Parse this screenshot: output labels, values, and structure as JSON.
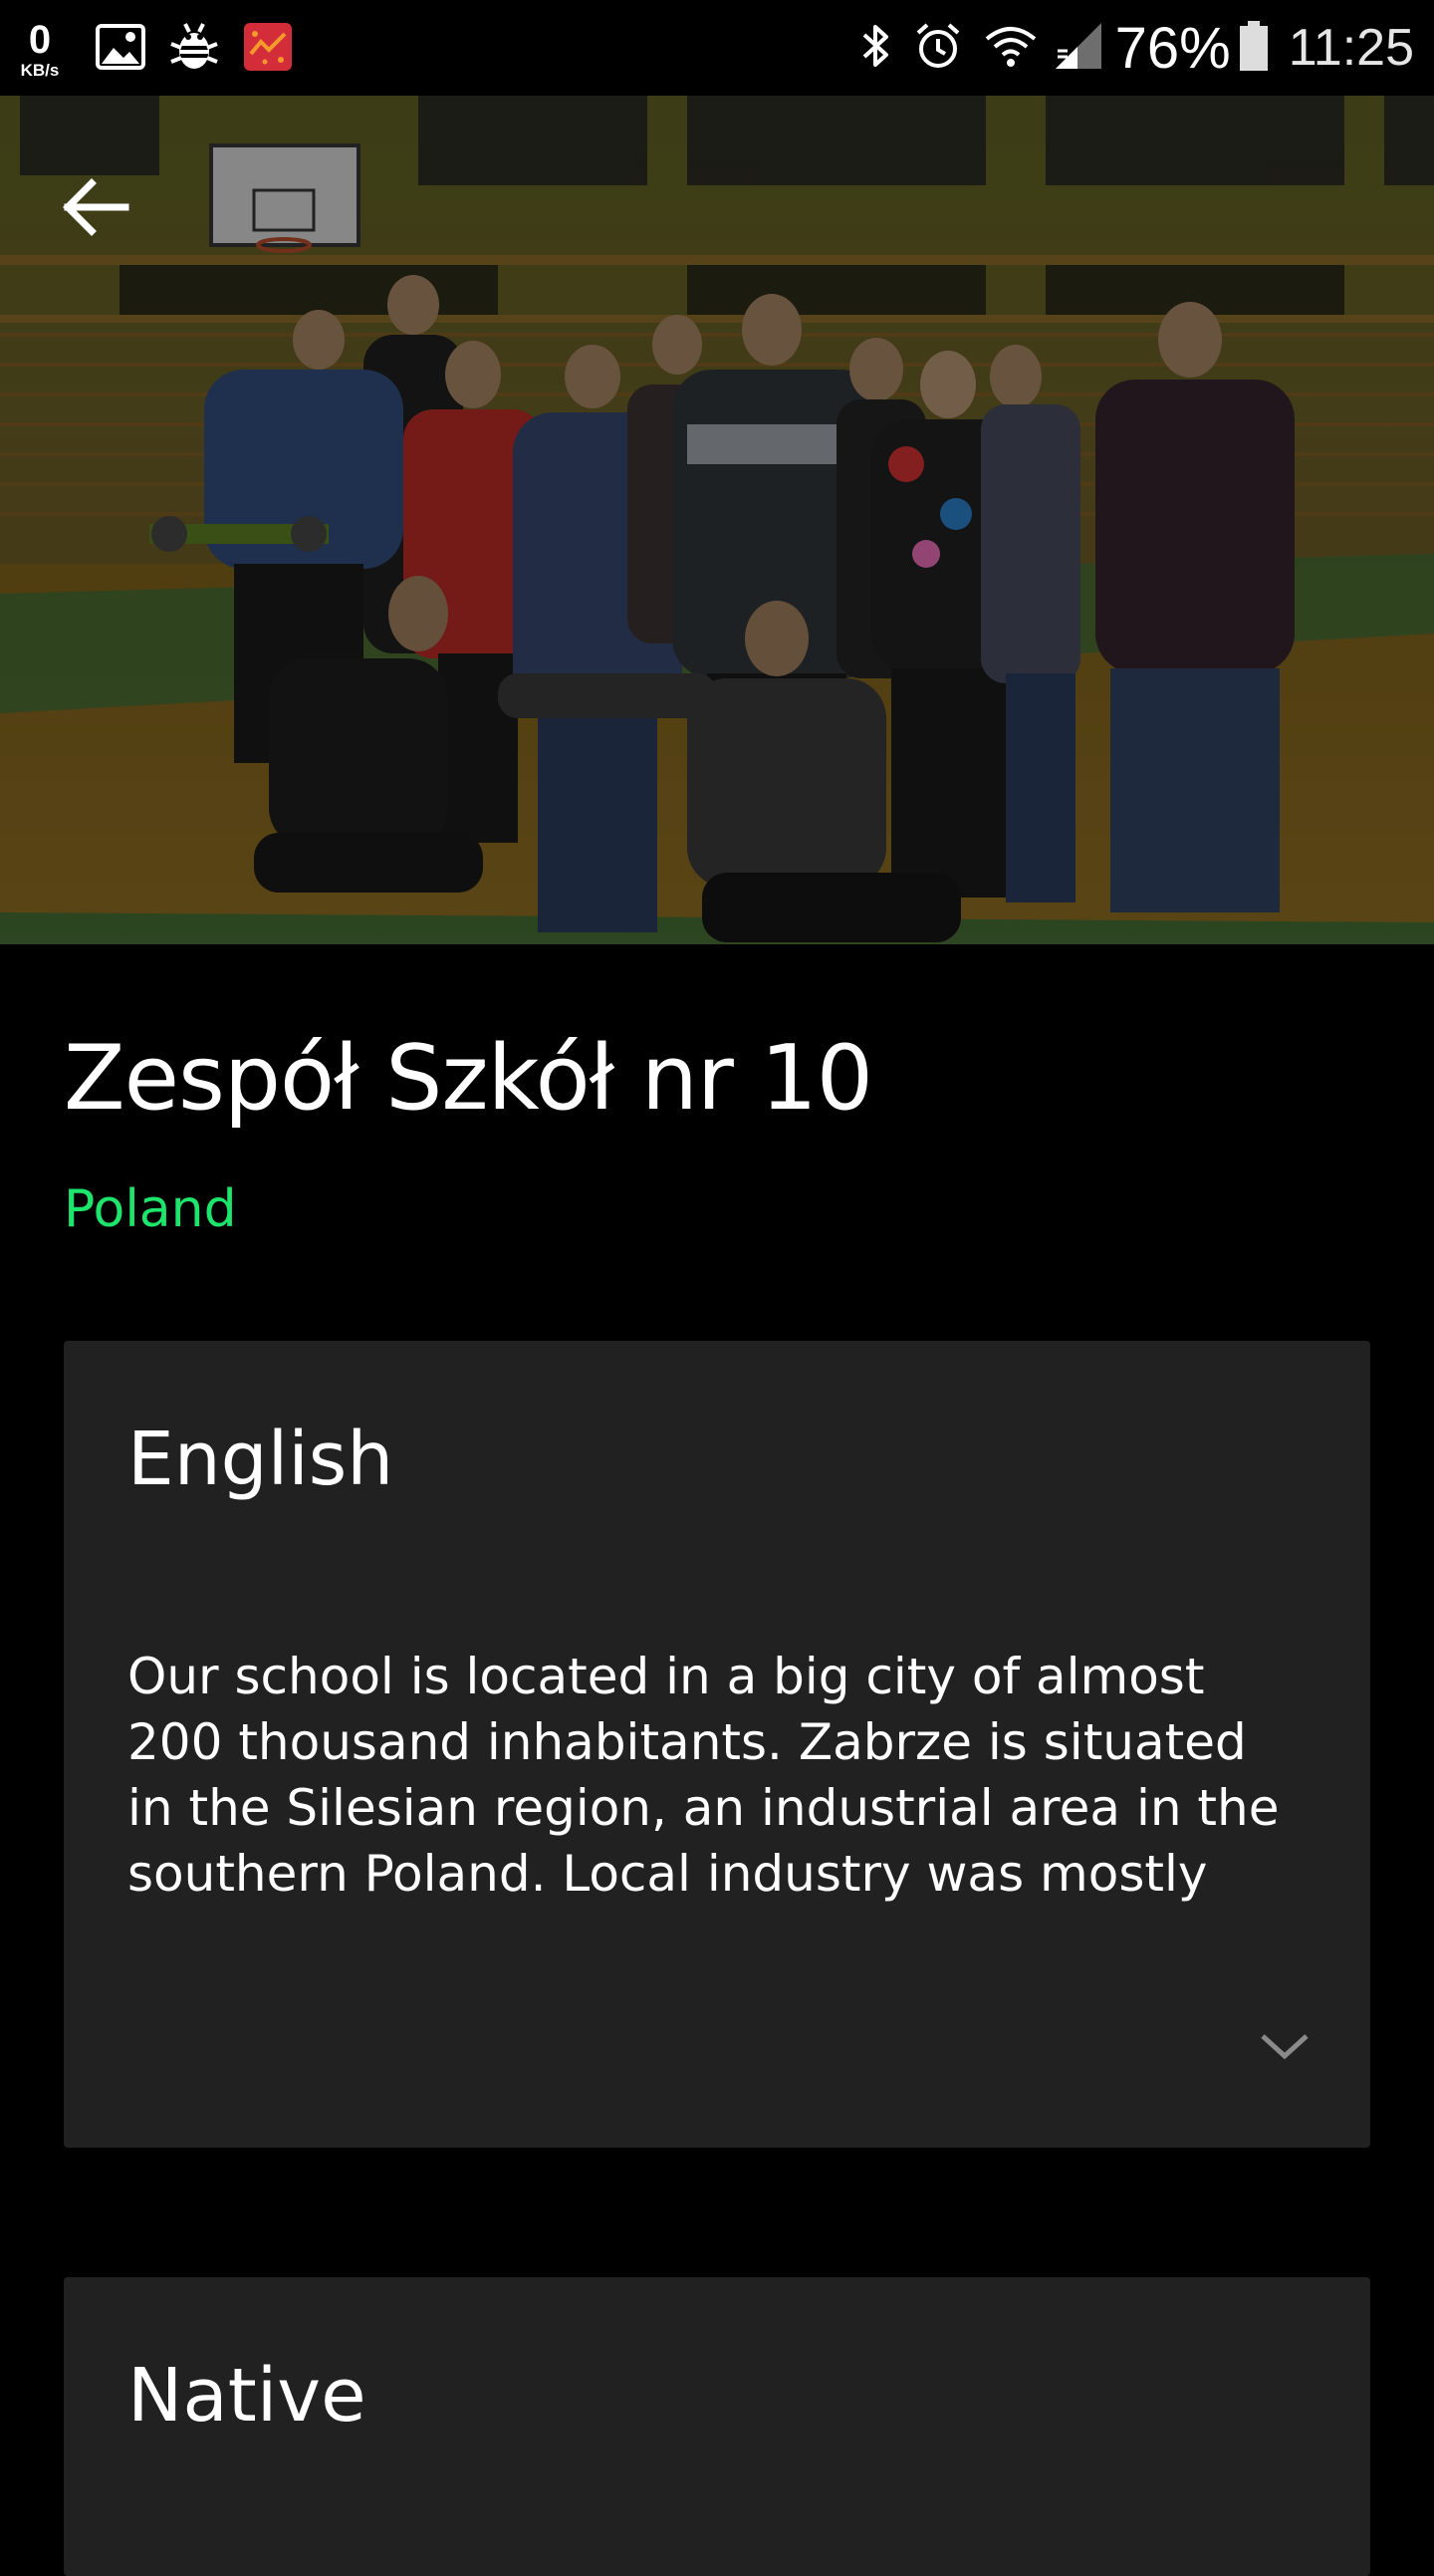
{
  "status_bar": {
    "net_speed_value": "0",
    "net_speed_unit": "KB/s",
    "battery_percent": "76%",
    "time": "11:25",
    "icons": [
      "gallery-icon",
      "bug-icon",
      "game-icon",
      "bluetooth-icon",
      "alarm-icon",
      "wifi-icon",
      "signal-icon",
      "battery-icon"
    ]
  },
  "hero": {
    "image": "group-photo",
    "back_icon": "arrow-back-icon"
  },
  "school": {
    "name": "Zespół Szkół nr 10",
    "country": "Poland"
  },
  "colors": {
    "accent": "#1de46a",
    "card_bg": "#212121",
    "background": "#000000"
  },
  "cards": [
    {
      "title": "English",
      "body": "Our school is located in a big city of almost 200 thousand inhabitants. Zabrze is situated in the Silesian region, an industrial area in the southern Poland. Local industry was mostly",
      "expand_icon": "chevron-down-icon"
    },
    {
      "title": "Native"
    }
  ]
}
